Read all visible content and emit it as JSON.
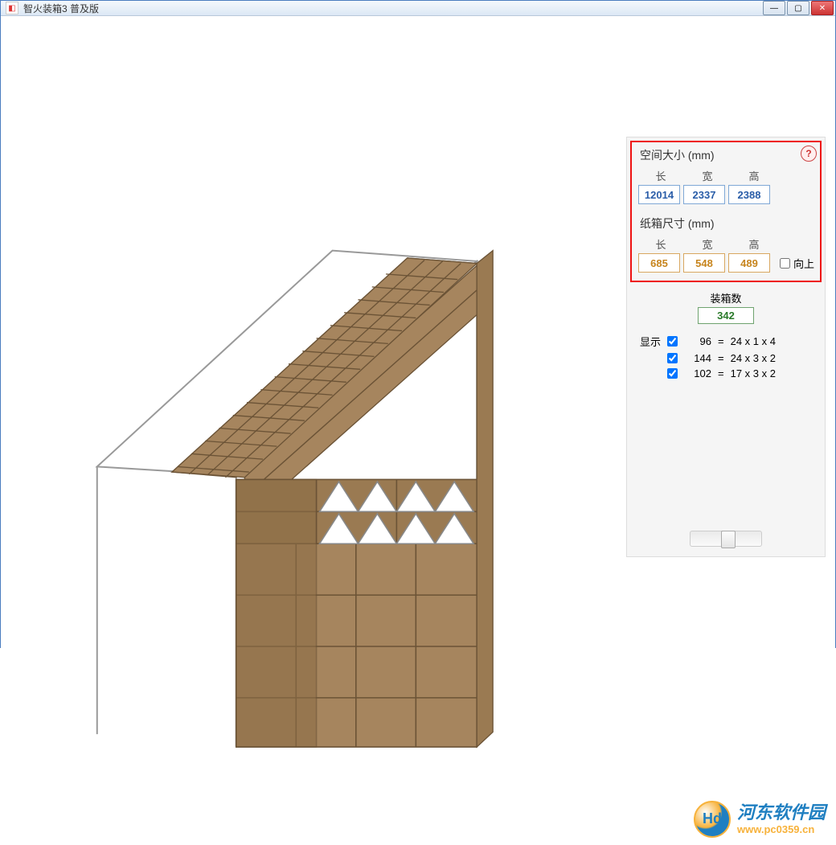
{
  "window": {
    "title": "智火装箱3 普及版"
  },
  "help_icon": "?",
  "space": {
    "title": "空间大小 (mm)",
    "labels": {
      "l": "长",
      "w": "宽",
      "h": "高"
    },
    "values": {
      "l": "12014",
      "w": "2337",
      "h": "2388"
    }
  },
  "box": {
    "title": "纸箱尺寸 (mm)",
    "labels": {
      "l": "长",
      "w": "宽",
      "h": "高"
    },
    "values": {
      "l": "685",
      "w": "548",
      "h": "489"
    },
    "upright_label": "向上",
    "upright_checked": false
  },
  "count": {
    "title": "装箱数",
    "value": "342"
  },
  "display": {
    "label": "显示",
    "rows": [
      {
        "checked": true,
        "count": "96",
        "expr": "24 x 1 x 4"
      },
      {
        "checked": true,
        "count": "144",
        "expr": "24 x 3 x 2"
      },
      {
        "checked": true,
        "count": "102",
        "expr": "17 x 3 x 2"
      }
    ]
  },
  "watermark": {
    "name": "河东软件园",
    "url": "www.pc0359.cn",
    "logo_text": "Hd"
  }
}
